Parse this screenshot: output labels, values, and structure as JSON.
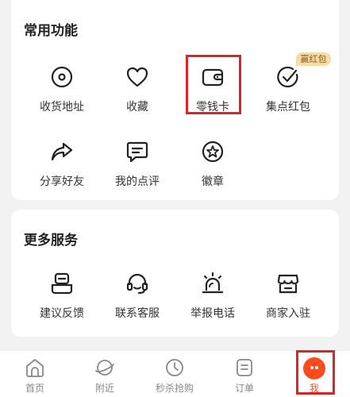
{
  "common": {
    "title": "常用功能",
    "items": [
      {
        "label": "收货地址",
        "icon": "location-icon"
      },
      {
        "label": "收藏",
        "icon": "heart-icon"
      },
      {
        "label": "零钱卡",
        "icon": "wallet-icon"
      },
      {
        "label": "集点红包",
        "icon": "check-circle-icon",
        "badge": "赢红包"
      },
      {
        "label": "分享好友",
        "icon": "share-icon"
      },
      {
        "label": "我的点评",
        "icon": "comment-icon"
      },
      {
        "label": "徽章",
        "icon": "badge-star-icon"
      }
    ]
  },
  "more": {
    "title": "更多服务",
    "items": [
      {
        "label": "建议反馈",
        "icon": "feedback-icon"
      },
      {
        "label": "联系客服",
        "icon": "headset-icon"
      },
      {
        "label": "举报电话",
        "icon": "alarm-icon"
      },
      {
        "label": "商家入驻",
        "icon": "store-icon"
      }
    ]
  },
  "tabbar": {
    "tabs": [
      {
        "label": "首页",
        "icon": "home-icon"
      },
      {
        "label": "附近",
        "icon": "planet-icon"
      },
      {
        "label": "秒杀抢购",
        "icon": "clock-icon"
      },
      {
        "label": "订单",
        "icon": "order-icon"
      },
      {
        "label": "我",
        "icon": "avatar-icon",
        "active": true
      }
    ]
  },
  "colors": {
    "accent": "#ff4d1a",
    "highlight": "#d9252a",
    "badge_bg": "#f7dca6"
  }
}
